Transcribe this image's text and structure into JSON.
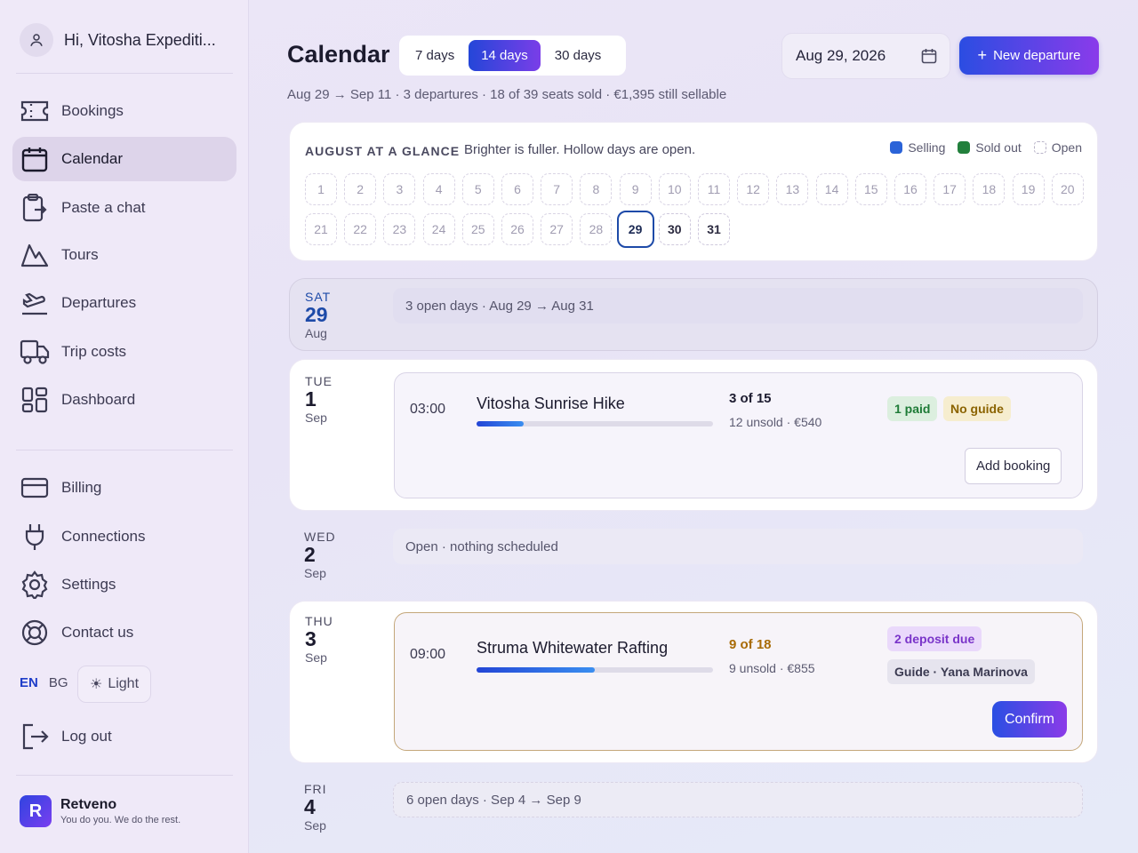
{
  "user": {
    "greeting": "Hi, Vitosha Expediti..."
  },
  "nav": {
    "items": [
      {
        "label": "Bookings",
        "icon": "ticket-icon"
      },
      {
        "label": "Calendar",
        "icon": "calendar-icon"
      },
      {
        "label": "Paste a chat",
        "icon": "clipboard-icon"
      },
      {
        "label": "Tours",
        "icon": "mountain-icon"
      },
      {
        "label": "Departures",
        "icon": "plane-departure-icon"
      },
      {
        "label": "Trip costs",
        "icon": "truck-icon"
      },
      {
        "label": "Dashboard",
        "icon": "dashboard-grid-icon"
      }
    ],
    "secondary": [
      {
        "label": "Billing",
        "icon": "credit-card-icon"
      },
      {
        "label": "Connections",
        "icon": "plug-icon"
      },
      {
        "label": "Settings",
        "icon": "gear-icon"
      },
      {
        "label": "Contact us",
        "icon": "lifebuoy-icon"
      }
    ],
    "logout": "Log out"
  },
  "lang": {
    "en": "EN",
    "bg": "BG"
  },
  "theme": {
    "label": "Light"
  },
  "brand": {
    "name": "Retveno",
    "tagline": "You do you. We do the rest."
  },
  "header": {
    "title": "Calendar",
    "ranges": [
      "7 days",
      "14 days",
      "30 days"
    ],
    "date": "Aug 29, 2026",
    "new_button": "New departure",
    "subtitle": "Aug 29 → Sep 11 · 3 departures · 18 of 39 seats sold · €1,395 still sellable"
  },
  "glance": {
    "heading": "AUGUST AT A GLANCE",
    "note": "Brighter is fuller. Hollow days are open.",
    "legend": {
      "selling": "Selling",
      "sold_out": "Sold out",
      "open": "Open"
    },
    "days": [
      "1",
      "2",
      "3",
      "4",
      "5",
      "6",
      "7",
      "8",
      "9",
      "10",
      "11",
      "12",
      "13",
      "14",
      "15",
      "16",
      "17",
      "18",
      "19",
      "20",
      "21",
      "22",
      "23",
      "24",
      "25",
      "26",
      "27",
      "28",
      "29",
      "30",
      "31"
    ]
  },
  "rows": {
    "r1": {
      "dow": "SAT",
      "day": "29",
      "mon": "Aug",
      "text": "3 open days · Aug 29 → Aug 31"
    },
    "r2": {
      "dow": "TUE",
      "day": "1",
      "mon": "Sep",
      "time": "03:00",
      "name": "Vitosha Sunrise Hike",
      "seats": "3 of 15",
      "unsold": "12 unsold · €540",
      "fill": 0.2,
      "badge1": "1 paid",
      "badge2": "No guide",
      "action": "Add booking"
    },
    "r3": {
      "dow": "WED",
      "day": "2",
      "mon": "Sep",
      "text": "Open · nothing scheduled"
    },
    "r4": {
      "dow": "THU",
      "day": "3",
      "mon": "Sep",
      "time": "09:00",
      "name": "Struma Whitewater Rafting",
      "seats": "9 of 18",
      "unsold": "9 unsold · €855",
      "fill": 0.5,
      "badge1": "2 deposit due",
      "badge2": "Guide · Yana Marinova",
      "action": "Confirm"
    },
    "r5": {
      "dow": "FRI",
      "day": "4",
      "mon": "Sep",
      "text": "6 open days · Sep 4 → Sep 9"
    }
  },
  "colors": {
    "accent": "#2446d8",
    "accent2": "#8a3bea",
    "selling": "#2a63d8",
    "sold_out": "#22803c"
  }
}
